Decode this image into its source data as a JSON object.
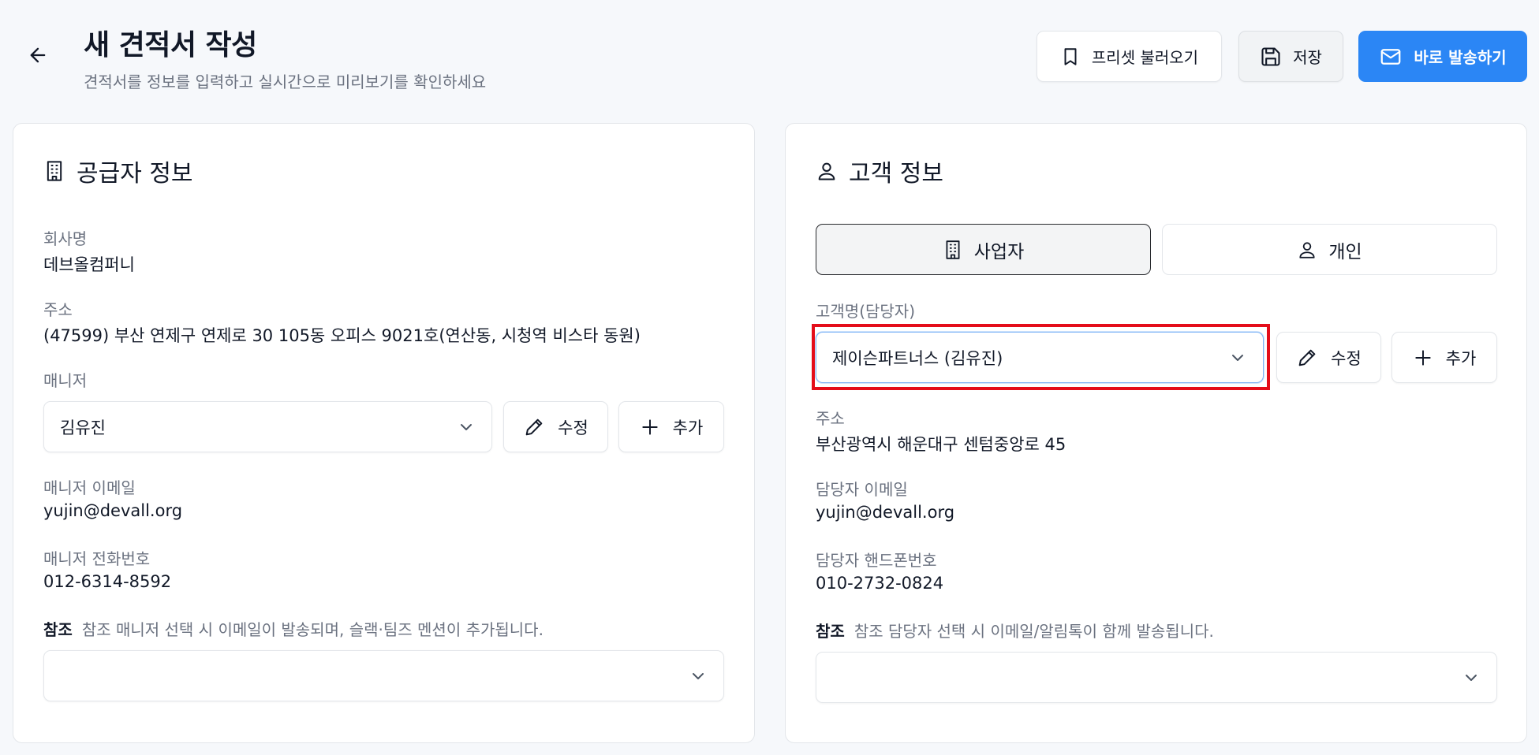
{
  "header": {
    "title": "새 견적서 작성",
    "subtitle": "견적서를 정보를 입력하고 실시간으로 미리보기를 확인하세요",
    "preset_label": "프리셋 불러오기",
    "save_label": "저장",
    "send_label": "바로 발송하기"
  },
  "colors": {
    "primary": "#2b86f5",
    "highlight": "#e40d1a",
    "muted_text": "#6b7280"
  },
  "supplier": {
    "title": "공급자 정보",
    "company_label": "회사명",
    "company_value": "데브올컴퍼니",
    "address_label": "주소",
    "address_value": "(47599) 부산 연제구 연제로 30 105동 오피스 9021호(연산동, 시청역 비스타 동원)",
    "manager_label": "매니저",
    "manager_selected": "김유진",
    "edit_label": "수정",
    "add_label": "추가",
    "email_label": "매니저 이메일",
    "email_value": "yujin@devall.org",
    "phone_label": "매니저 전화번호",
    "phone_value": "012-6314-8592",
    "ref_label": "참조",
    "ref_note": "참조 매니저 선택 시 이메일이 발송되며, 슬랙·팀즈 멘션이 추가됩니다.",
    "ref_selected": ""
  },
  "customer": {
    "title": "고객 정보",
    "tab_business": "사업자",
    "tab_individual": "개인",
    "name_label": "고객명(담당자)",
    "name_selected": "제이슨파트너스 (김유진)",
    "edit_label": "수정",
    "add_label": "추가",
    "address_label": "주소",
    "address_value": "부산광역시 해운대구 센텀중앙로 45",
    "email_label": "담당자 이메일",
    "email_value": "yujin@devall.org",
    "phone_label": "담당자 핸드폰번호",
    "phone_value": "010-2732-0824",
    "ref_label": "참조",
    "ref_note": "참조 담당자 선택 시 이메일/알림톡이 함께 발송됩니다.",
    "ref_selected": ""
  }
}
